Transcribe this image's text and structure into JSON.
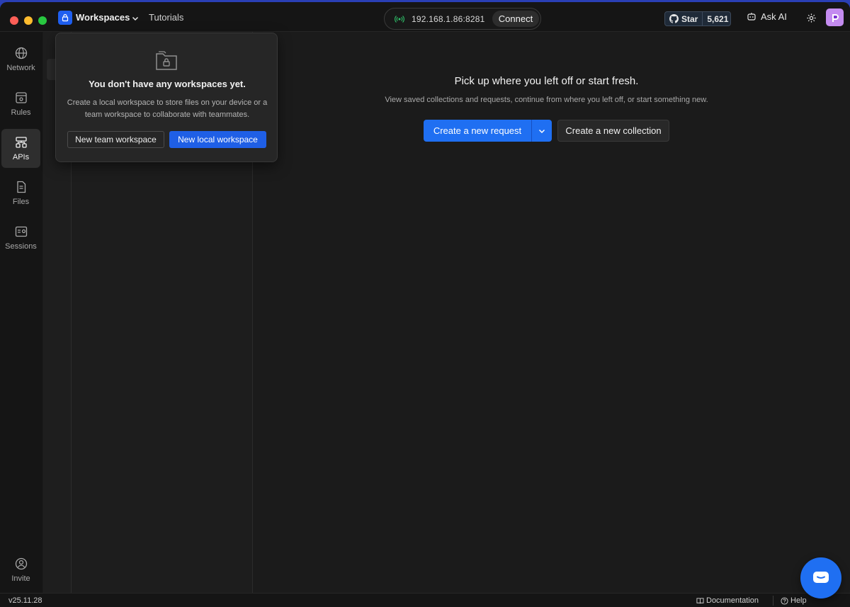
{
  "titlebar": {
    "workspace_label": "Workspaces",
    "tutorials_label": "Tutorials",
    "ip_address": "192.168.1.86:8281",
    "connect_label": "Connect",
    "github_star_label": "Star",
    "github_star_count": "5,621",
    "ask_ai_label": "Ask AI"
  },
  "nav": {
    "items": [
      {
        "label": "Network",
        "icon": "globe-icon"
      },
      {
        "label": "Rules",
        "icon": "rules-icon"
      },
      {
        "label": "APIs",
        "icon": "apis-icon",
        "active": true
      },
      {
        "label": "Files",
        "icon": "files-icon"
      },
      {
        "label": "Sessions",
        "icon": "sessions-icon"
      }
    ],
    "invite_label": "Invite"
  },
  "popover": {
    "title": "You don't have any workspaces yet.",
    "description": "Create a local workspace to store files on your device or a team workspace to collaborate with teammates.",
    "team_button": "New team workspace",
    "local_button": "New local workspace"
  },
  "main": {
    "title": "Pick up where you left off or start fresh.",
    "subtitle": "View saved collections and requests, continue from where you left off, or start something new.",
    "create_request_label": "Create a new request",
    "create_collection_label": "Create a new collection"
  },
  "statusbar": {
    "version": "v25.11.28",
    "documentation_label": "Documentation",
    "help_label": "Help"
  },
  "colors": {
    "accent": "#1f6ff2",
    "background": "#1b1b1b",
    "avatar": "#c48cf0"
  }
}
